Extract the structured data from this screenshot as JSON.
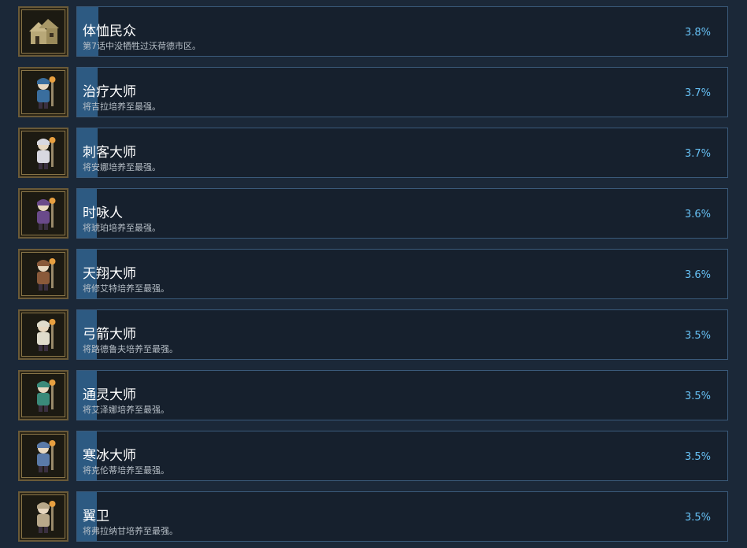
{
  "achievements": [
    {
      "title": "体恤民众",
      "description": "第7话中没牺牲过沃荷德市区。",
      "percent": "3.8%",
      "progress": 0.038,
      "icon": "village-house-icon",
      "color": "#c9b98a"
    },
    {
      "title": "治疗大师",
      "description": "将吉拉培养至最强。",
      "percent": "3.7%",
      "progress": 0.037,
      "icon": "healer-character-icon",
      "color": "#3a6e9e"
    },
    {
      "title": "刺客大师",
      "description": "将安娜培养至最强。",
      "percent": "3.7%",
      "progress": 0.037,
      "icon": "assassin-character-icon",
      "color": "#d8d8e0"
    },
    {
      "title": "时咏人",
      "description": "将琥珀培养至最强。",
      "percent": "3.6%",
      "progress": 0.036,
      "icon": "chanter-character-icon",
      "color": "#6a4a8a"
    },
    {
      "title": "天翔大师",
      "description": "将修艾特培养至最强。",
      "percent": "3.6%",
      "progress": 0.036,
      "icon": "skyborne-character-icon",
      "color": "#8a5a3a"
    },
    {
      "title": "弓箭大师",
      "description": "将路德鲁夫培养至最强。",
      "percent": "3.5%",
      "progress": 0.035,
      "icon": "archer-character-icon",
      "color": "#e0dccc"
    },
    {
      "title": "通灵大师",
      "description": "将艾泽娜培养至最强。",
      "percent": "3.5%",
      "progress": 0.035,
      "icon": "necromancer-character-icon",
      "color": "#3a8a7a"
    },
    {
      "title": "寒冰大师",
      "description": "将克伦蒂培养至最强。",
      "percent": "3.5%",
      "progress": 0.035,
      "icon": "ice-mage-character-icon",
      "color": "#5a7aa8"
    },
    {
      "title": "翼卫",
      "description": "将弗拉纳甘培养至最强。",
      "percent": "3.5%",
      "progress": 0.035,
      "icon": "wing-guard-character-icon",
      "color": "#b8a88a"
    }
  ]
}
